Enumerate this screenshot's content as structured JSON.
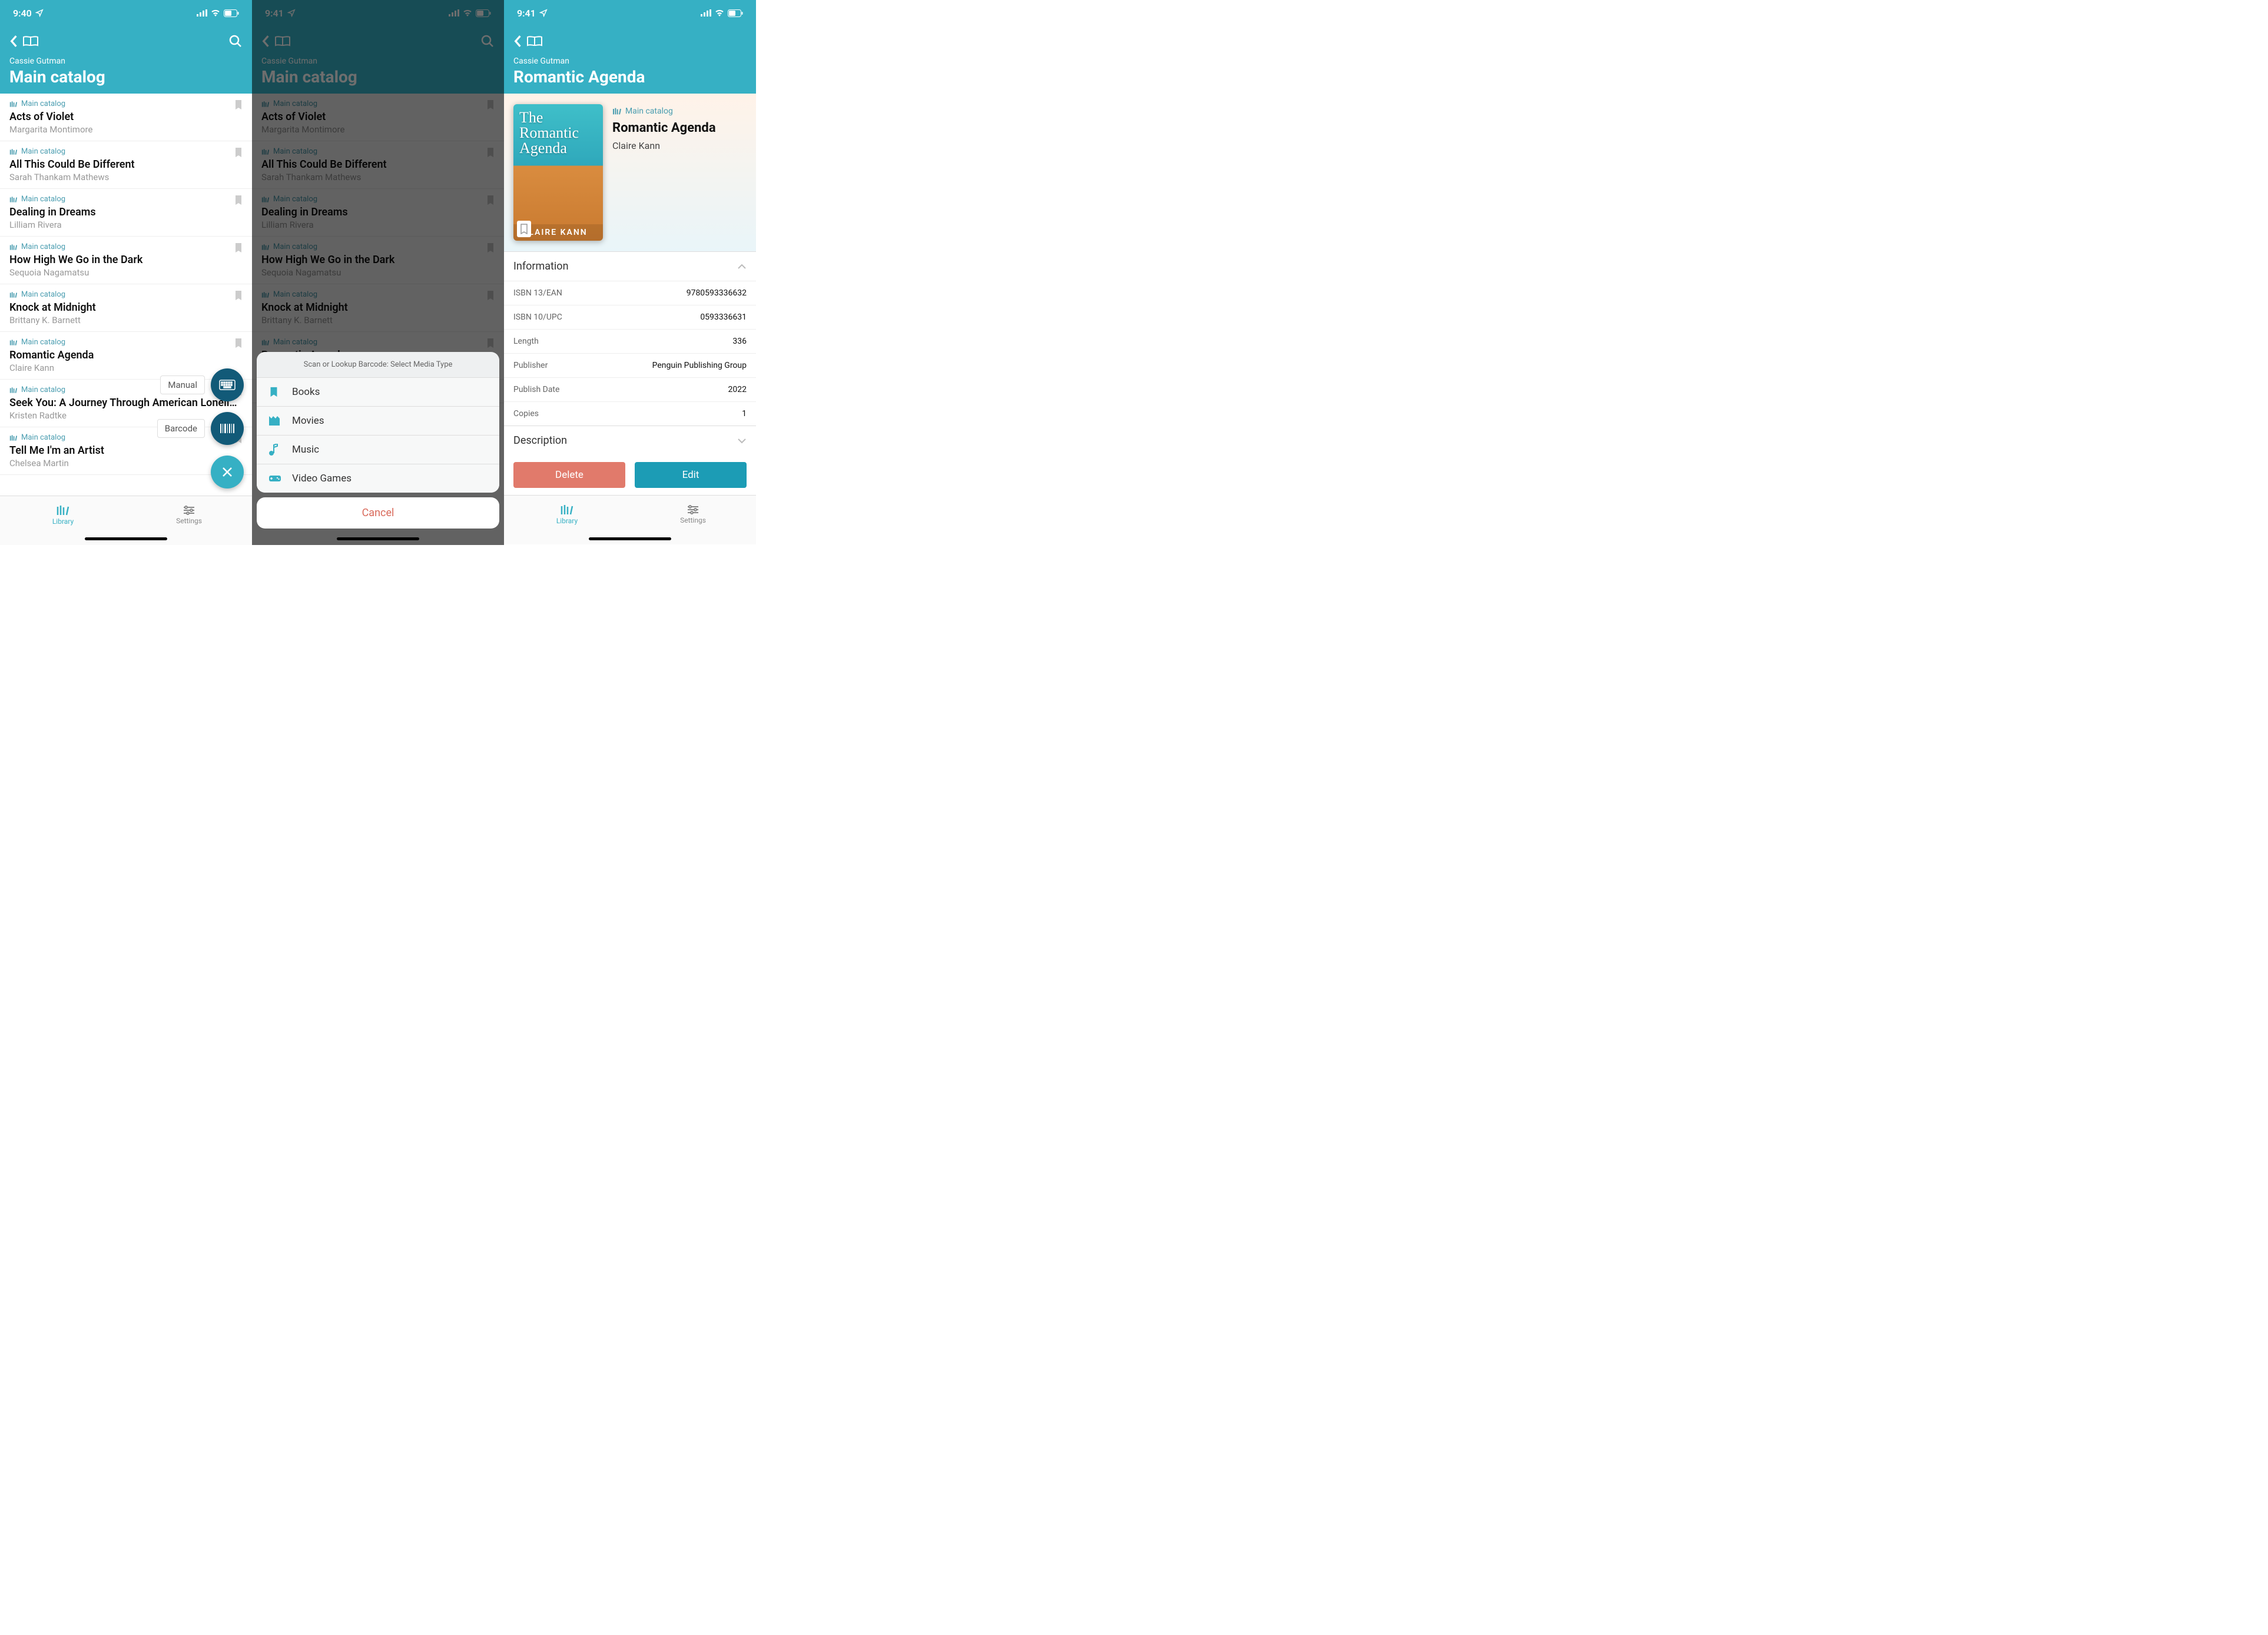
{
  "status": {
    "time1": "9:40",
    "time2": "9:41",
    "time3": "9:41"
  },
  "user": "Cassie Gutman",
  "catalog_title": "Main catalog",
  "catalog_label": "Main catalog",
  "books": [
    {
      "title": "Acts of Violet",
      "author": "Margarita Montimore"
    },
    {
      "title": "All This Could Be Different",
      "author": "Sarah Thankam Mathews"
    },
    {
      "title": "Dealing in Dreams",
      "author": "Lilliam Rivera"
    },
    {
      "title": "How High We Go in the Dark",
      "author": "Sequoia Nagamatsu"
    },
    {
      "title": "Knock at Midnight",
      "author": "Brittany K. Barnett"
    },
    {
      "title": "Romantic Agenda",
      "author": "Claire Kann"
    },
    {
      "title": "Seek You: A Journey Through American Lonelin…",
      "author": "Kristen Radtke"
    },
    {
      "title": "Tell Me I'm an Artist",
      "author": "Chelsea Martin"
    }
  ],
  "fab": {
    "manual": "Manual",
    "barcode": "Barcode"
  },
  "nav": {
    "library": "Library",
    "settings": "Settings"
  },
  "sheet": {
    "title": "Scan or Lookup Barcode: Select Media Type",
    "items": [
      "Books",
      "Movies",
      "Music",
      "Video Games"
    ],
    "cancel": "Cancel"
  },
  "detail": {
    "header_title": "Romantic Agenda",
    "catalog": "Main catalog",
    "title": "Romantic Agenda",
    "author": "Claire Kann",
    "cover_title": "The Romantic Agenda",
    "cover_author": "LAIRE KANN",
    "info_label": "Information",
    "desc_label": "Description",
    "fields": [
      {
        "k": "ISBN 13/EAN",
        "v": "9780593336632"
      },
      {
        "k": "ISBN 10/UPC",
        "v": "0593336631"
      },
      {
        "k": "Length",
        "v": "336"
      },
      {
        "k": "Publisher",
        "v": "Penguin Publishing Group"
      },
      {
        "k": "Publish Date",
        "v": "2022"
      },
      {
        "k": "Copies",
        "v": "1"
      }
    ],
    "delete": "Delete",
    "edit": "Edit"
  }
}
